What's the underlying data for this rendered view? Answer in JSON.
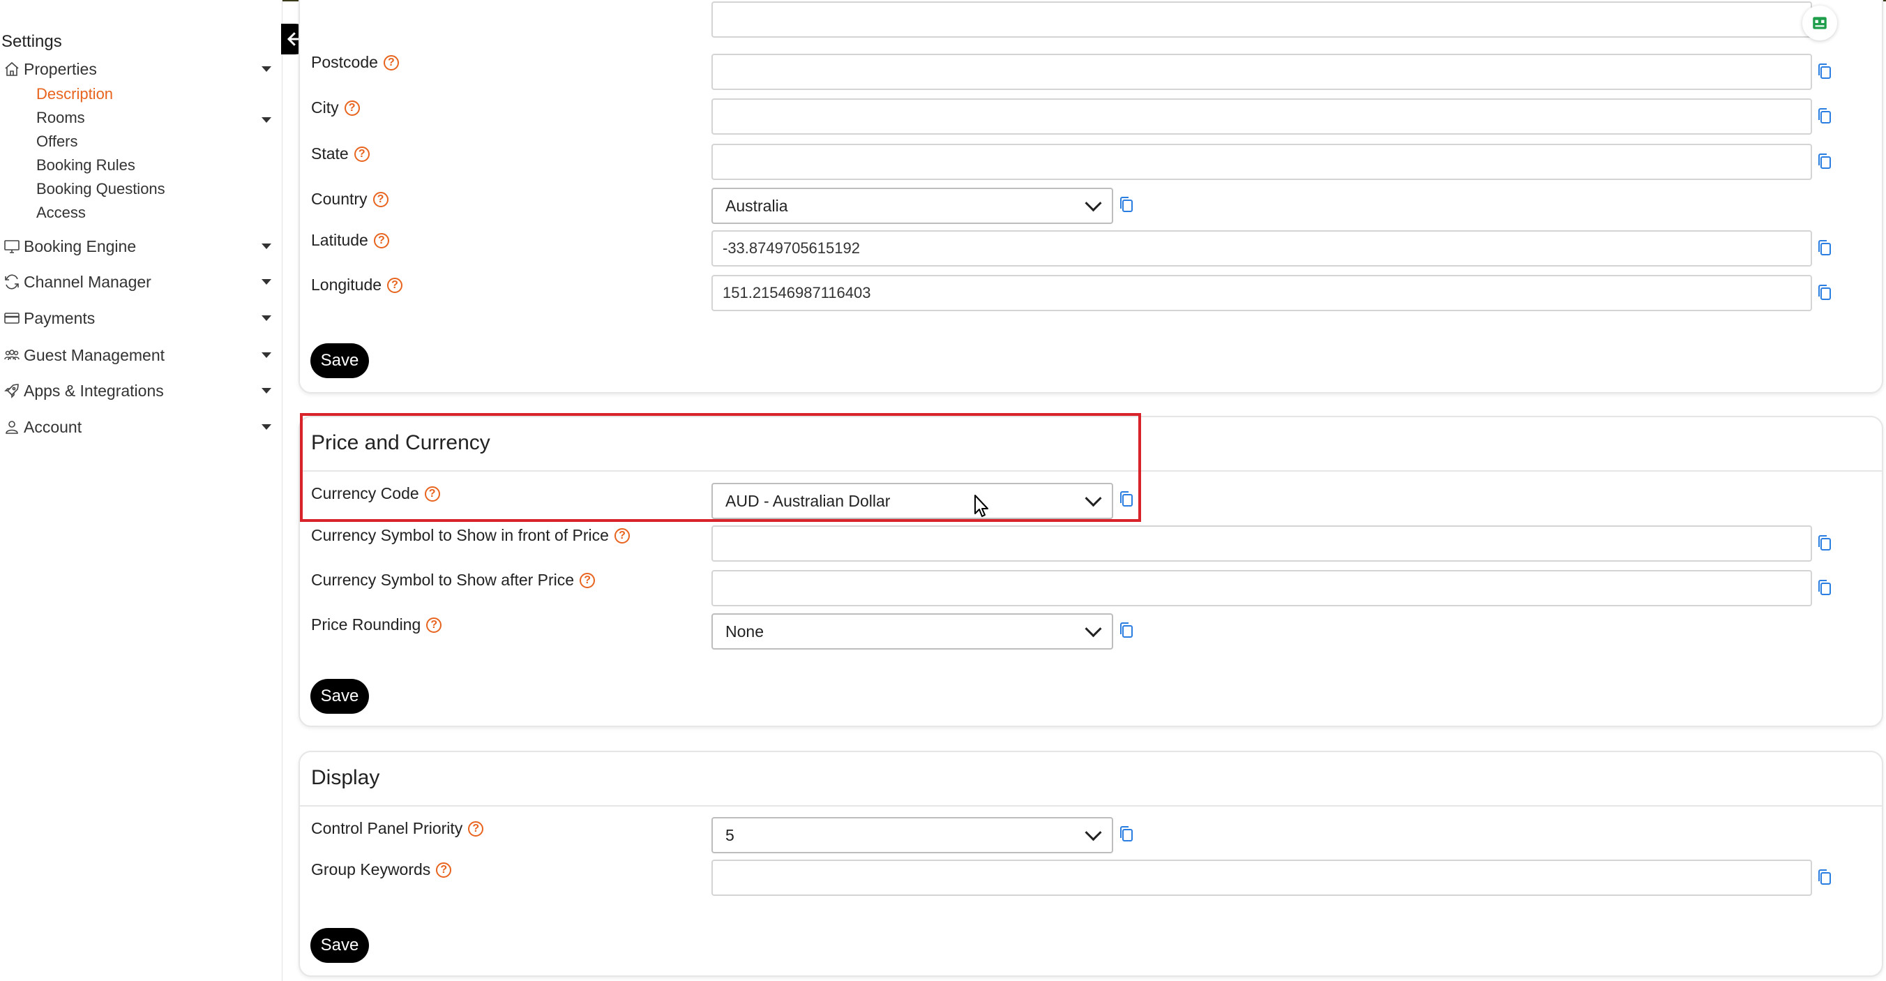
{
  "sidebar": {
    "title": "Settings",
    "items": [
      {
        "label": "Properties",
        "icon": "home-icon"
      },
      {
        "label": "Booking Engine",
        "icon": "monitor-icon"
      },
      {
        "label": "Channel Manager",
        "icon": "sync-icon"
      },
      {
        "label": "Payments",
        "icon": "credit-card-icon"
      },
      {
        "label": "Guest Management",
        "icon": "users-icon"
      },
      {
        "label": "Apps & Integrations",
        "icon": "rocket-icon"
      },
      {
        "label": "Account",
        "icon": "user-icon"
      }
    ],
    "sub_items": [
      "Description",
      "Rooms",
      "Offers",
      "Booking Rules",
      "Booking Questions",
      "Access"
    ],
    "active_sub": "Description"
  },
  "location_card": {
    "fields": [
      {
        "label": "Postcode",
        "value": ""
      },
      {
        "label": "City",
        "value": ""
      },
      {
        "label": "State",
        "value": ""
      },
      {
        "label": "Country",
        "value": "Australia"
      },
      {
        "label": "Latitude",
        "value": "-33.8749705615192"
      },
      {
        "label": "Longitude",
        "value": "151.21546987116403"
      }
    ],
    "save_label": "Save"
  },
  "price_card": {
    "title": "Price and Currency",
    "fields": [
      {
        "label": "Currency Code",
        "value": "AUD - Australian Dollar"
      },
      {
        "label": "Currency Symbol to Show in front of Price",
        "value": ""
      },
      {
        "label": "Currency Symbol to Show after Price",
        "value": ""
      },
      {
        "label": "Price Rounding",
        "value": "None"
      }
    ],
    "save_label": "Save"
  },
  "display_card": {
    "title": "Display",
    "fields": [
      {
        "label": "Control Panel Priority",
        "value": "5"
      },
      {
        "label": "Group Keywords",
        "value": ""
      }
    ],
    "save_label": "Save"
  },
  "colors": {
    "accent": "#e8641e",
    "highlight": "#d9232a",
    "primary_button": "#000000"
  }
}
